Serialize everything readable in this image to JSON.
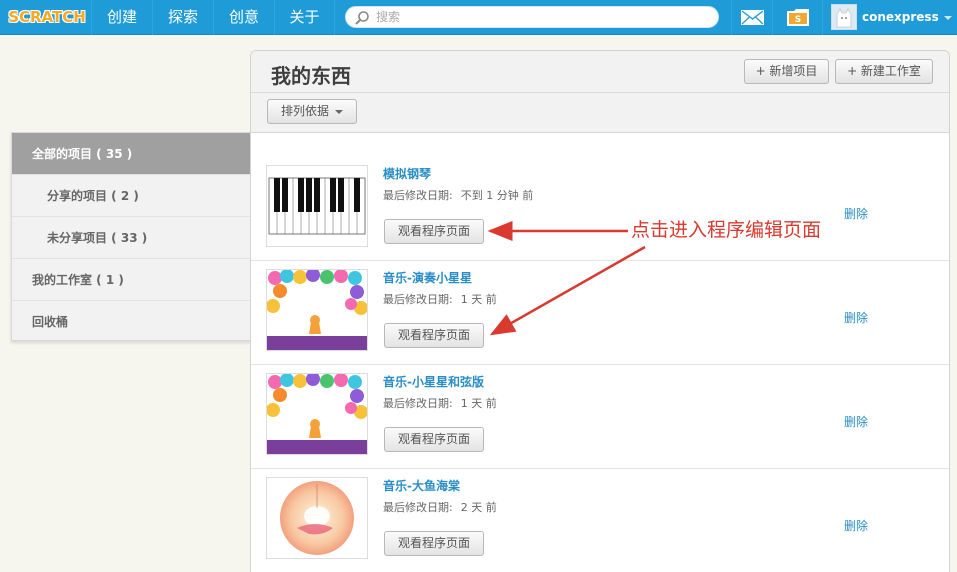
{
  "nav": {
    "logo": "SCRATCH",
    "items": [
      "创建",
      "探索",
      "创意",
      "关于"
    ],
    "search_placeholder": "搜索",
    "username": "conexpress"
  },
  "sidebar": {
    "items": [
      {
        "label": "全部的项目 ( 35 )",
        "active": true
      },
      {
        "label": "分享的项目 ( 2 )",
        "active": false
      },
      {
        "label": "未分享项目 ( 33 )",
        "active": false
      },
      {
        "label": "我的工作室 ( 1 )",
        "active": false
      },
      {
        "label": "回收桶",
        "active": false
      }
    ]
  },
  "main": {
    "title": "我的东西",
    "new_project": "+ 新增项目",
    "new_studio": "+ 新建工作室",
    "sort_label": "排列依据"
  },
  "projects": [
    {
      "title": "模拟钢琴",
      "date_label": "最后修改日期:",
      "date_value": "不到 1 分钟 前",
      "view_label": "观看程序页面",
      "delete_label": "删除",
      "thumb": "piano"
    },
    {
      "title": "音乐-演奏小星星",
      "date_label": "最后修改日期:",
      "date_value": "1 天 前",
      "view_label": "观看程序页面",
      "delete_label": "删除",
      "thumb": "balloons"
    },
    {
      "title": "音乐-小星星和弦版",
      "date_label": "最后修改日期:",
      "date_value": "1 天 前",
      "view_label": "观看程序页面",
      "delete_label": "删除",
      "thumb": "balloons"
    },
    {
      "title": "音乐-大鱼海棠",
      "date_label": "最后修改日期:",
      "date_value": "2 天 前",
      "view_label": "观看程序页面",
      "delete_label": "删除",
      "thumb": "fish"
    }
  ],
  "annotation": {
    "text": "点击进入程序编辑页面",
    "color": "#d9392e"
  },
  "colors": {
    "nav_bg": "#1f9cd8",
    "link": "#2a8ec6",
    "sidebar_active": "#a0a0a0"
  }
}
